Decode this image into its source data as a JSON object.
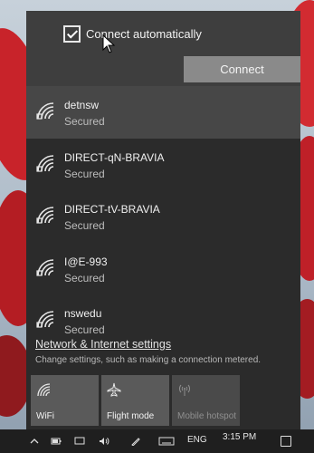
{
  "flyout": {
    "auto_connect_label": "Connect automatically",
    "auto_connect_checked": true,
    "connect_button": "Connect"
  },
  "networks": [
    {
      "name": "detnsw",
      "status": "Secured"
    },
    {
      "name": "DIRECT-qN-BRAVIA",
      "status": "Secured"
    },
    {
      "name": "DIRECT-tV-BRAVIA",
      "status": "Secured"
    },
    {
      "name": "I@E-993",
      "status": "Secured"
    },
    {
      "name": "nswedu",
      "status": "Secured"
    }
  ],
  "settings": {
    "link": "Network & Internet settings",
    "description": "Change settings, such as making a connection metered."
  },
  "quick_actions": [
    {
      "label": "WiFi",
      "icon": "wifi-icon"
    },
    {
      "label": "Flight mode",
      "icon": "airplane-icon"
    },
    {
      "label": "Mobile hotspot",
      "icon": "hotspot-icon"
    }
  ],
  "taskbar": {
    "language": "ENG",
    "time": "3:15 PM"
  },
  "colors": {
    "flyout_bg": "#2b2b2b",
    "selected_bg": "#474747",
    "connect_button": "#8a8a8a",
    "tile": "#5a5a5a"
  }
}
